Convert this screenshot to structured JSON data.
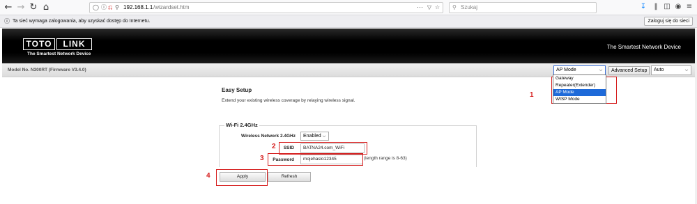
{
  "browser": {
    "url_host": "192.168.1.1",
    "url_path": "/wizardset.htm",
    "search_placeholder": "Szukaj"
  },
  "notification": {
    "text": "Ta sieć wymaga zalogowania, aby uzyskać dostęp do Internetu.",
    "button_label": "Zaloguj się do sieci"
  },
  "header": {
    "logo_left": "TOTO",
    "logo_right": "LINK",
    "tagline": "The Smartest Network Device",
    "right_text": "The Smartest Network Device"
  },
  "model_row": {
    "model_text": "Model No. N300RT (Firmware V3.4.0)",
    "mode_select_value": "AP Mode",
    "advanced_button": "Advanced Setup",
    "language_select_value": "Auto"
  },
  "mode_dropdown": {
    "options": [
      "Gateway",
      "Repeater(Extender)",
      "AP Mode",
      "WISP Mode"
    ],
    "selected": "AP Mode"
  },
  "easy_setup": {
    "title": "Easy Setup",
    "description": "Extend your existing wireless coverage by relaying wireless signal."
  },
  "wifi": {
    "legend": "Wi-Fi 2.4GHz",
    "wireless_label": "Wireless Network 2.4GHz",
    "wireless_value": "Enabled",
    "ssid_label": "SSID",
    "ssid_value": "BATNA24.com_WiFi",
    "password_label": "Password",
    "password_value": "mojehaslo12345",
    "password_hint": "(length range is 8-63)"
  },
  "buttons": {
    "apply": "Apply",
    "refresh": "Refresh"
  },
  "annotations": {
    "n1": "1",
    "n2": "2",
    "n3": "3",
    "n4": "4",
    "color": "#d61f1f"
  }
}
